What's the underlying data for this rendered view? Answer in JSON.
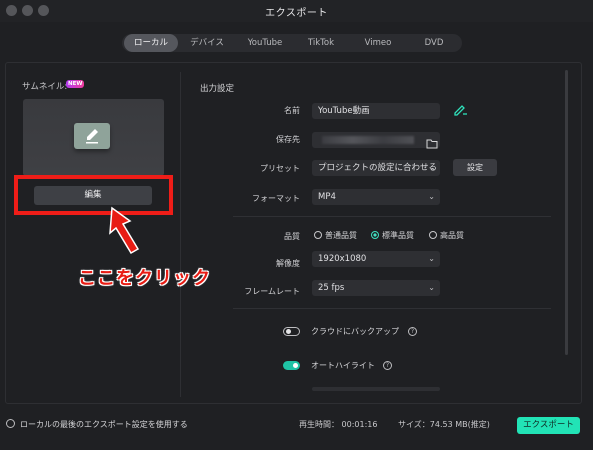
{
  "window": {
    "title": "エクスポート"
  },
  "tabs": [
    {
      "label": "ローカル",
      "active": true
    },
    {
      "label": "デバイス",
      "active": false
    },
    {
      "label": "YouTube",
      "active": false
    },
    {
      "label": "TikTok",
      "active": false
    },
    {
      "label": "Vimeo",
      "active": false
    },
    {
      "label": "DVD",
      "active": false
    }
  ],
  "thumbnail": {
    "label": "サムネイル:",
    "badge": "NEW",
    "edit_button": "編集"
  },
  "annotation": {
    "text": "ここをクリック",
    "color": "#e81c14"
  },
  "output": {
    "section_title": "出力設定",
    "name": {
      "label": "名前",
      "value": "YouTube動画"
    },
    "save_to": {
      "label": "保存先",
      "value": ""
    },
    "preset": {
      "label": "プリセット",
      "value": "プロジェクトの設定に合わせる",
      "button": "設定"
    },
    "format": {
      "label": "フォーマット",
      "value": "MP4"
    },
    "quality": {
      "label": "品質",
      "options": [
        "普通品質",
        "標準品質",
        "高品質"
      ],
      "selected": "標準品質"
    },
    "resolution": {
      "label": "解像度",
      "value": "1920x1080"
    },
    "framerate": {
      "label": "フレームレート",
      "value": "25 fps"
    },
    "cloud_backup": {
      "label": "クラウドにバックアップ",
      "enabled": false
    },
    "auto_highlight": {
      "label": "オートハイライト",
      "enabled": true
    }
  },
  "footer": {
    "use_last_settings": "ローカルの最後のエクスポート設定を使用する",
    "duration": "再生時間：  00:01:16",
    "size": "サイズ：74.53 MB(推定)",
    "export_button": "エクスポート"
  },
  "colors": {
    "accent": "#22e3b6",
    "background": "#1f2023",
    "annotation_red": "#ef1d18"
  },
  "icons": [
    "edit-pencil-icon",
    "ai-pen-icon",
    "folder-icon",
    "chevron-down-icon",
    "help-icon"
  ]
}
